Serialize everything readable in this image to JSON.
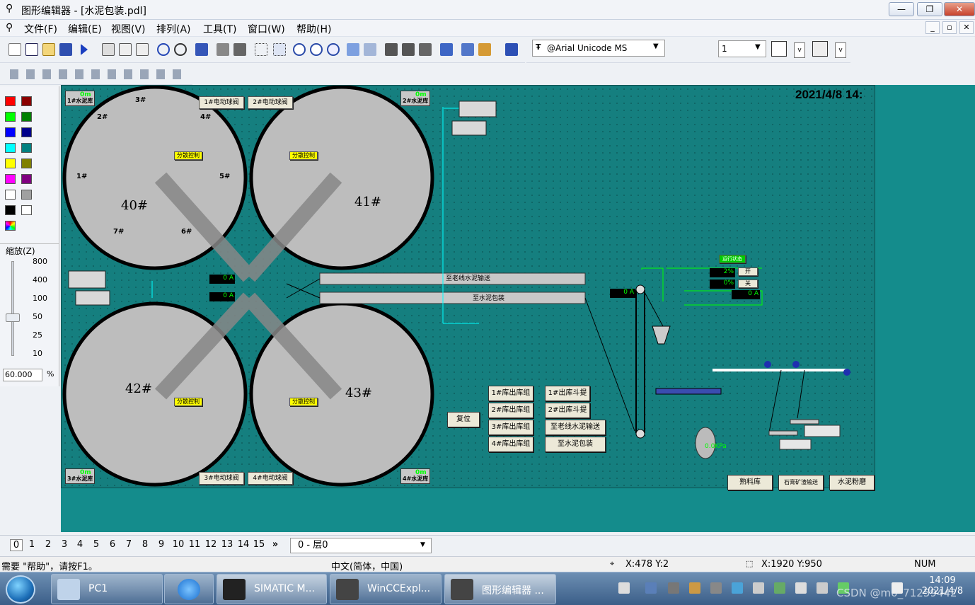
{
  "window": {
    "title": "图形编辑器 - [水泥包装.pdl]",
    "minimize": "—",
    "restore": "❐",
    "close": "✕"
  },
  "menu": [
    "文件(F)",
    "编辑(E)",
    "视图(V)",
    "排列(A)",
    "工具(T)",
    "窗口(W)",
    "帮助(H)"
  ],
  "mdi": {
    "minimize": "_",
    "restore": "▫",
    "close": "✕"
  },
  "font": {
    "name": "@Arial Unicode MS",
    "size": "1"
  },
  "zoom": {
    "label": "缩放(Z)",
    "marks": [
      "800",
      "400",
      "100",
      "50",
      "25",
      "10"
    ],
    "value": "60.000",
    "unit": "%"
  },
  "canvas": {
    "datetime": "2021/4/8 14:",
    "silo_tags": [
      {
        "n": "0m",
        "t": "1#水泥库"
      },
      {
        "n": "0m",
        "t": "2#水泥库"
      },
      {
        "n": "0m",
        "t": "3#水泥库"
      },
      {
        "n": "0m",
        "t": "4#水泥库"
      }
    ],
    "valve_labels": [
      "1#电动球阀",
      "2#电动球阀",
      "3#电动球阀",
      "4#电动球阀"
    ],
    "silo_names": [
      "40#",
      "41#",
      "42#",
      "43#"
    ],
    "sub_bins": [
      "1#",
      "2#",
      "3#",
      "4#",
      "5#",
      "6#",
      "7#"
    ],
    "pct": "%",
    "control": "分散控制",
    "conveyor_labels": [
      "至老线水泥输送",
      "至水泥包装"
    ],
    "buttons": [
      "复位",
      "1#库出库组",
      "1#出库斗提",
      "2#库出库组",
      "2#出库斗提",
      "3#库出库组",
      "至老线水泥输送",
      "4#库出库组",
      "至水泥包装"
    ],
    "nav_buttons": [
      "熟料库",
      "石膏矿渣输送",
      "水泥粉磨"
    ],
    "small": {
      "open": "开",
      "close": "关",
      "run": "运行状态",
      "amp": "0 A",
      "pressure": "0.0KPa",
      "level_pct": "2%",
      "level2": "0%"
    }
  },
  "layers": {
    "tabs": [
      "0",
      "1",
      "2",
      "3",
      "4",
      "5",
      "6",
      "7",
      "8",
      "9",
      "10",
      "11",
      "12",
      "13",
      "14",
      "15"
    ],
    "more": "»",
    "selected": "0 - 层0"
  },
  "status": {
    "help": "需要 \"帮助\"，请按F1。",
    "lang": "中文(简体，中国)",
    "pos": "X:478 Y:2",
    "size": "X:1920 Y:950",
    "num": "NUM"
  },
  "taskbar": {
    "items": [
      "PC1",
      "SIMATIC M...",
      "WinCCExpl...",
      "图形编辑器 ..."
    ],
    "time": "14:09",
    "date": "2021/4/8",
    "watermark": "CSDN @m0_71259442"
  },
  "colors": {
    "canvas": "#157f7f",
    "silo": "#bdbdbd"
  }
}
